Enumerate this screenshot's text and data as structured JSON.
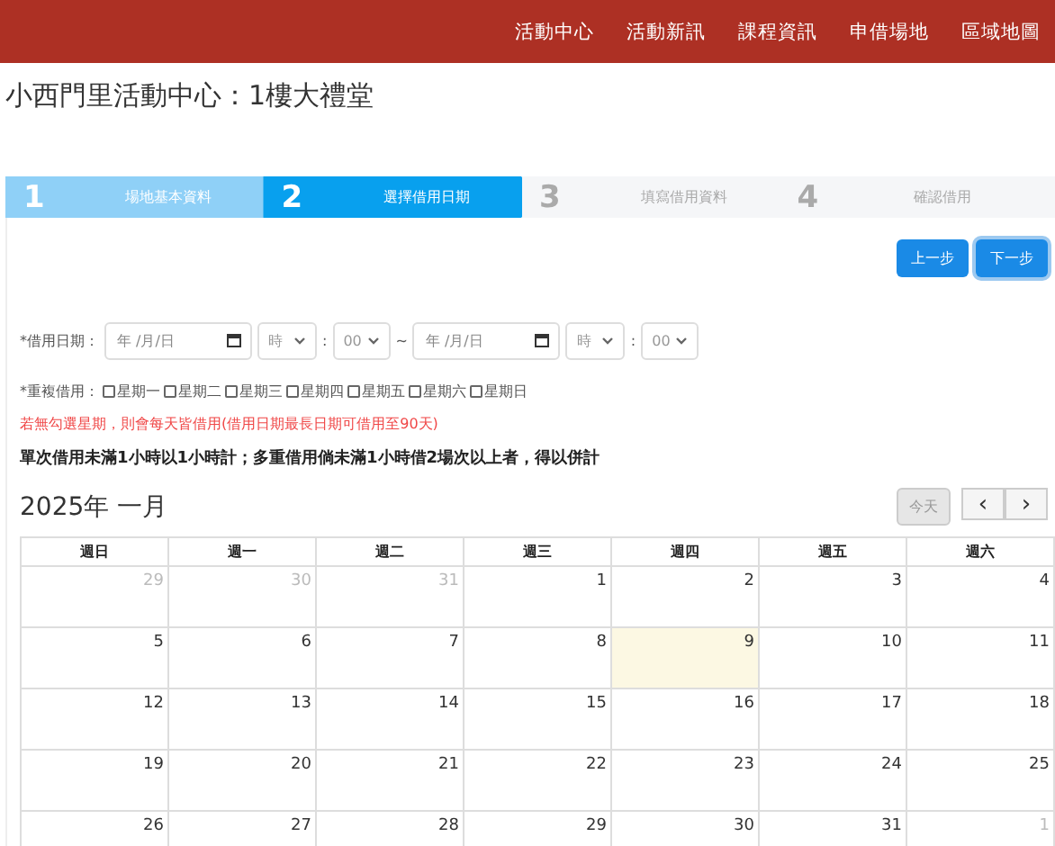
{
  "nav": [
    "活動中心",
    "活動新訊",
    "課程資訊",
    "申借場地",
    "區域地圖"
  ],
  "title": "小西門里活動中心：1樓大禮堂",
  "steps": [
    {
      "number": "1",
      "label": "場地基本資料",
      "kind": "done"
    },
    {
      "number": "2",
      "label": "選擇借用日期",
      "kind": "current"
    },
    {
      "number": "3",
      "label": "填寫借用資料",
      "kind": "todo"
    },
    {
      "number": "4",
      "label": "確認借用",
      "kind": "todo"
    }
  ],
  "buttons": [
    {
      "label": "上一步",
      "focused": false
    },
    {
      "label": "下一步",
      "focused": true
    }
  ],
  "date_row": {
    "label": "*借用日期：",
    "start_date": {
      "placeholder": "年 /月/日"
    },
    "start_hour": "時",
    "start_minute": "00",
    "separator": "~",
    "end_date": {
      "placeholder": "年 /月/日"
    },
    "end_hour": "時",
    "end_minute": "00",
    "colon": ":"
  },
  "repeat": {
    "label": "*重複借用：",
    "days": [
      {
        "label": "星期一",
        "checked": false
      },
      {
        "label": "星期二",
        "checked": false
      },
      {
        "label": "星期三",
        "checked": false
      },
      {
        "label": "星期四",
        "checked": false
      },
      {
        "label": "星期五",
        "checked": false
      },
      {
        "label": "星期六",
        "checked": false
      },
      {
        "label": "星期日",
        "checked": false
      }
    ]
  },
  "warning": "若無勾選星期，則會每天皆借用(借用日期最長日期可借用至90天)",
  "rule": "單次借用未滿1小時以1小時計；多重借用倘未滿1小時借2場次以上者，得以併計",
  "calendar": {
    "title": "2025年 一月",
    "today_button": {
      "label": "今天",
      "disabled": true
    },
    "prev": "‹",
    "next": "›",
    "weekdays": [
      "週日",
      "週一",
      "週二",
      "週三",
      "週四",
      "週五",
      "週六"
    ],
    "weeks": [
      [
        {
          "day": "29",
          "other_month": true,
          "today": false
        },
        {
          "day": "30",
          "other_month": true,
          "today": false
        },
        {
          "day": "31",
          "other_month": true,
          "today": false
        },
        {
          "day": "1",
          "other_month": false,
          "today": false
        },
        {
          "day": "2",
          "other_month": false,
          "today": false
        },
        {
          "day": "3",
          "other_month": false,
          "today": false
        },
        {
          "day": "4",
          "other_month": false,
          "today": false
        }
      ],
      [
        {
          "day": "5",
          "other_month": false,
          "today": false
        },
        {
          "day": "6",
          "other_month": false,
          "today": false
        },
        {
          "day": "7",
          "other_month": false,
          "today": false
        },
        {
          "day": "8",
          "other_month": false,
          "today": false
        },
        {
          "day": "9",
          "other_month": false,
          "today": true
        },
        {
          "day": "10",
          "other_month": false,
          "today": false
        },
        {
          "day": "11",
          "other_month": false,
          "today": false
        }
      ],
      [
        {
          "day": "12",
          "other_month": false,
          "today": false
        },
        {
          "day": "13",
          "other_month": false,
          "today": false
        },
        {
          "day": "14",
          "other_month": false,
          "today": false
        },
        {
          "day": "15",
          "other_month": false,
          "today": false
        },
        {
          "day": "16",
          "other_month": false,
          "today": false
        },
        {
          "day": "17",
          "other_month": false,
          "today": false
        },
        {
          "day": "18",
          "other_month": false,
          "today": false
        }
      ],
      [
        {
          "day": "19",
          "other_month": false,
          "today": false
        },
        {
          "day": "20",
          "other_month": false,
          "today": false
        },
        {
          "day": "21",
          "other_month": false,
          "today": false
        },
        {
          "day": "22",
          "other_month": false,
          "today": false
        },
        {
          "day": "23",
          "other_month": false,
          "today": false
        },
        {
          "day": "24",
          "other_month": false,
          "today": false
        },
        {
          "day": "25",
          "other_month": false,
          "today": false
        }
      ],
      [
        {
          "day": "26",
          "other_month": false,
          "today": false
        },
        {
          "day": "27",
          "other_month": false,
          "today": false
        },
        {
          "day": "28",
          "other_month": false,
          "today": false
        },
        {
          "day": "29",
          "other_month": false,
          "today": false
        },
        {
          "day": "30",
          "other_month": false,
          "today": false
        },
        {
          "day": "31",
          "other_month": false,
          "today": false
        },
        {
          "day": "1",
          "other_month": true,
          "today": false
        }
      ]
    ]
  }
}
